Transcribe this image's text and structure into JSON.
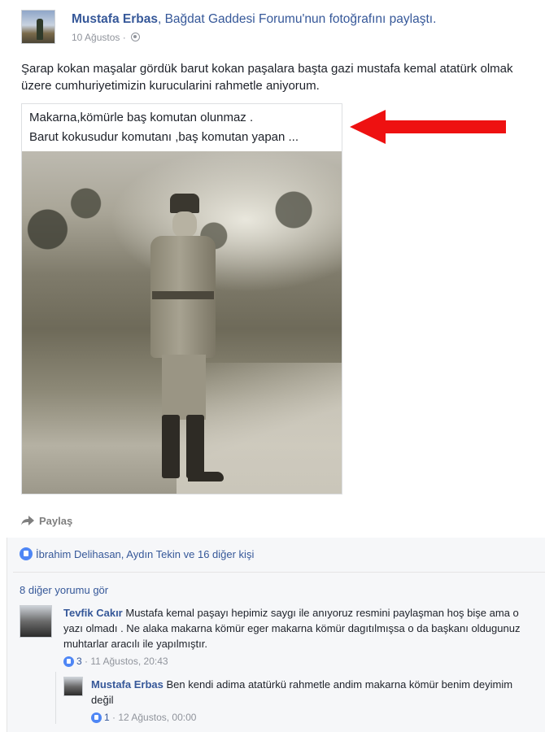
{
  "post": {
    "author": "Mustafa Erbas",
    "action": ", Bağdat Gaddesi Forumu'nun fotoğrafını paylaştı.",
    "date": "10 Ağustos",
    "separator": "·",
    "privacy_icon": "globe-icon",
    "text": "Şarap kokan maşalar gördük barut kokan paşalara başta gazi mustafa kemal atatürk olmak üzere cumhuriyetimizin kurucularini rahmetle aniyorum."
  },
  "photo": {
    "caption_line1": "Makarna,kömürle baş komutan olunmaz .",
    "caption_line2": "Barut kokusudur komutanı ,baş komutan yapan ..."
  },
  "annotation": {
    "arrow_color": "#ee1111"
  },
  "actions": {
    "share_label": "Paylaş",
    "share_icon": "share-icon"
  },
  "reactions": {
    "likers": "İbrahim Delihasan, Aydın Tekin ve 16 diğer kişi"
  },
  "comments": {
    "more_label": "8 diğer yorumu gör",
    "items": [
      {
        "author": "Tevfik Cakır",
        "text": "Mustafa kemal paşayı hepimiz saygı ile anıyoruz resmini paylaşman hoş bişe ama o yazı olmadı . Ne alaka makarna kömür eger makarna kömür dagıtılmışsa o da başkanı oldugunuz muhtarlar aracılı ile yapılmıştır.",
        "like_count": "3",
        "time": "· 11 Ağustos, 20:43"
      }
    ],
    "reply": {
      "author": "Mustafa Erbas",
      "text": "Ben kendi adima atatürkü rahmetle andim makarna kömür benim deyimim değil",
      "like_count": "1",
      "time": "· 12 Ağustos, 00:00"
    }
  },
  "colors": {
    "link": "#365899",
    "meta": "#90949c",
    "like_blue": "#4e86f5"
  }
}
